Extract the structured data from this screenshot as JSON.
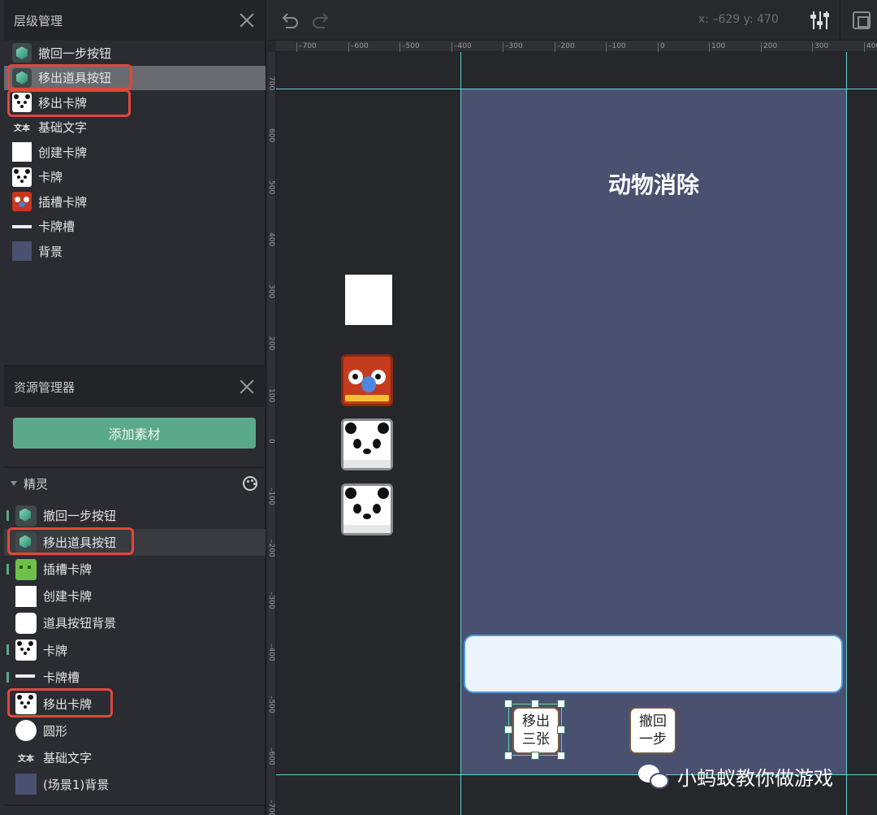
{
  "hierarchy_panel": {
    "title": "层级管理",
    "items": [
      {
        "label": "撤回一步按钮",
        "icon": "cube-icon",
        "selected": false
      },
      {
        "label": "移出道具按钮",
        "icon": "cube-icon",
        "selected": true
      },
      {
        "label": "移出卡牌",
        "icon": "panda-icon",
        "selected": false
      },
      {
        "label": "基础文字",
        "icon": "text-icon",
        "selected": false
      },
      {
        "label": "创建卡牌",
        "icon": "white-square-icon",
        "selected": false
      },
      {
        "label": "卡牌",
        "icon": "panda-icon",
        "selected": false
      },
      {
        "label": "插槽卡牌",
        "icon": "parrot-icon",
        "selected": false
      },
      {
        "label": "卡牌槽",
        "icon": "slot-bar-icon",
        "selected": false
      },
      {
        "label": "背景",
        "icon": "background-icon",
        "selected": false
      }
    ]
  },
  "assets_panel": {
    "title": "资源管理器",
    "add_button": "添加素材",
    "section_label": "精灵",
    "items": [
      {
        "label": "撤回一步按钮",
        "icon": "cube-icon"
      },
      {
        "label": "移出道具按钮",
        "icon": "cube-icon"
      },
      {
        "label": "插槽卡牌",
        "icon": "green-monster-icon"
      },
      {
        "label": "创建卡牌",
        "icon": "white-square-icon"
      },
      {
        "label": "道具按钮背景",
        "icon": "rounded-square-icon"
      },
      {
        "label": "卡牌",
        "icon": "panda-icon"
      },
      {
        "label": "卡牌槽",
        "icon": "slot-bar-icon"
      },
      {
        "label": "移出卡牌",
        "icon": "panda-icon"
      },
      {
        "label": "圆形",
        "icon": "circle-icon"
      },
      {
        "label": "基础文字",
        "icon": "text-icon"
      },
      {
        "label": "(场景1)背景",
        "icon": "background-icon"
      }
    ]
  },
  "toolbar": {
    "coords": "x: –629  y: 470"
  },
  "ruler": {
    "top_ticks": [
      "–700",
      "–600",
      "–500",
      "–400",
      "–300",
      "–200",
      "–100",
      "0",
      "100",
      "200",
      "300",
      "400"
    ],
    "left_ticks": [
      "700",
      "600",
      "500",
      "400",
      "300",
      "200",
      "100",
      "0",
      "–100",
      "–200",
      "–300",
      "–400",
      "–500",
      "–600",
      "–700"
    ]
  },
  "stage": {
    "title": "动物消除",
    "remove_button": "移出\n三张",
    "undo_button": "撤回\n一步",
    "background_color": "#495070",
    "slot_color": "#ecf4fe"
  },
  "icon_text_glyph": "文本",
  "watermark": "小蚂蚁教你做游戏",
  "colors": {
    "accent_green": "#5aa98a",
    "highlight_red": "#e0473c",
    "guide_cyan": "#66d0d2"
  }
}
